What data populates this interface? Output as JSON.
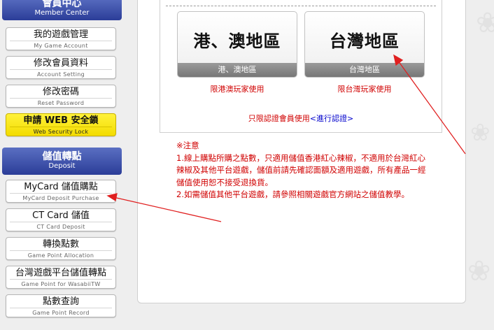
{
  "sidebar": {
    "member_center": {
      "title": "會員中心",
      "subtitle": "Member Center"
    },
    "member_items": [
      {
        "label": "我的遊戲管理",
        "sublabel": "My Game Account"
      },
      {
        "label": "修改會員資料",
        "sublabel": "Account Setting"
      },
      {
        "label": "修改密碼",
        "sublabel": "Reset Password"
      },
      {
        "label": "申請 WEB 安全鎖",
        "sublabel": "Web Security Lock"
      }
    ],
    "deposit": {
      "title": "儲值轉點",
      "subtitle": "Deposit"
    },
    "deposit_items": [
      {
        "label": "MyCard 儲值購點",
        "sublabel": "MyCard Deposit Purchase"
      },
      {
        "label": "CT Card 儲值",
        "sublabel": "CT Card Deposit"
      },
      {
        "label": "轉換點數",
        "sublabel": "Game Point Allocation"
      },
      {
        "label": "台灣遊戲平台儲值轉點",
        "sublabel": "Game Point for WasabiiTW"
      },
      {
        "label": "點數查詢",
        "sublabel": "Game Point Record"
      }
    ]
  },
  "regions": [
    {
      "title": "港、澳地區",
      "bar": "港、澳地區",
      "note": "限港澳玩家使用"
    },
    {
      "title": "台灣地區",
      "bar": "台灣地區",
      "note": "限台灣玩家使用"
    }
  ],
  "verify": {
    "text": "只限認證會員使用",
    "link_open": "<",
    "link": "進行認證",
    "link_close": ">"
  },
  "notice": {
    "title": "※注意",
    "items": [
      "1.線上購點所購之點數，只適用儲值香港紅心辣椒，不適用於台灣紅心辣椒及其他平台遊戲，儲值前請先確認面額及適用遊戲，所有產品一經儲值使用恕不接受退換貨。",
      "2.如需儲值其他平台遊戲，請參照相關遊戲官方網站之儲值教學。"
    ]
  },
  "colors": {
    "header_blue": "#2b3d98",
    "notice_red": "#d00000",
    "link_blue": "#0000cc",
    "arrow_red": "#e02020",
    "highlight_yellow": "#fff23a"
  }
}
